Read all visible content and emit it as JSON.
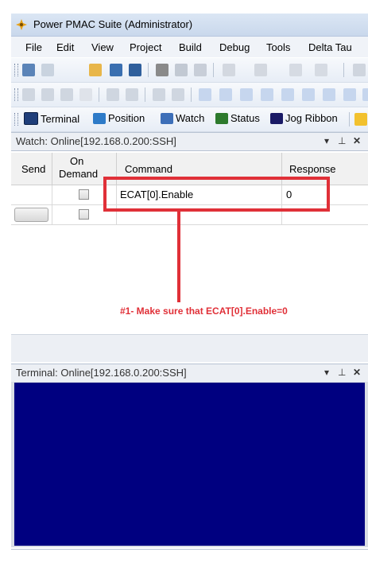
{
  "window": {
    "title": "Power PMAC Suite (Administrator)"
  },
  "menu": [
    "File",
    "Edit",
    "View",
    "Project",
    "Build",
    "Debug",
    "Tools",
    "Delta Tau"
  ],
  "window_toolbar": [
    {
      "label": "Terminal",
      "icon": "terminal-icon",
      "color": "#1f3e7a"
    },
    {
      "label": "Position",
      "icon": "position-icon",
      "color": "#2e7bc8"
    },
    {
      "label": "Watch",
      "icon": "watch-icon",
      "color": "#3d6fb8"
    },
    {
      "label": "Status",
      "icon": "status-icon",
      "color": "#2d7a2d"
    },
    {
      "label": "Jog Ribbon",
      "icon": "jog-ribbon-icon",
      "color": "#1a1a66"
    }
  ],
  "watch_panel": {
    "title": "Watch: Online[192.168.0.200:SSH]",
    "pin": "▾ ⊥ ✕",
    "columns": {
      "send": "Send",
      "on_demand_1": "On",
      "on_demand_2": "Demand",
      "command": "Command",
      "response": "Response"
    },
    "rows": [
      {
        "command": "ECAT[0].Enable",
        "response": "0"
      },
      {
        "command": "",
        "response": ""
      }
    ]
  },
  "annotation": {
    "text": "#1- Make sure that ECAT[0].Enable=0",
    "color": "#e03038"
  },
  "terminal_panel": {
    "title": "Terminal: Online[192.168.0.200:SSH]",
    "pin": "▾ ⊥ ✕",
    "background": "#000080"
  }
}
